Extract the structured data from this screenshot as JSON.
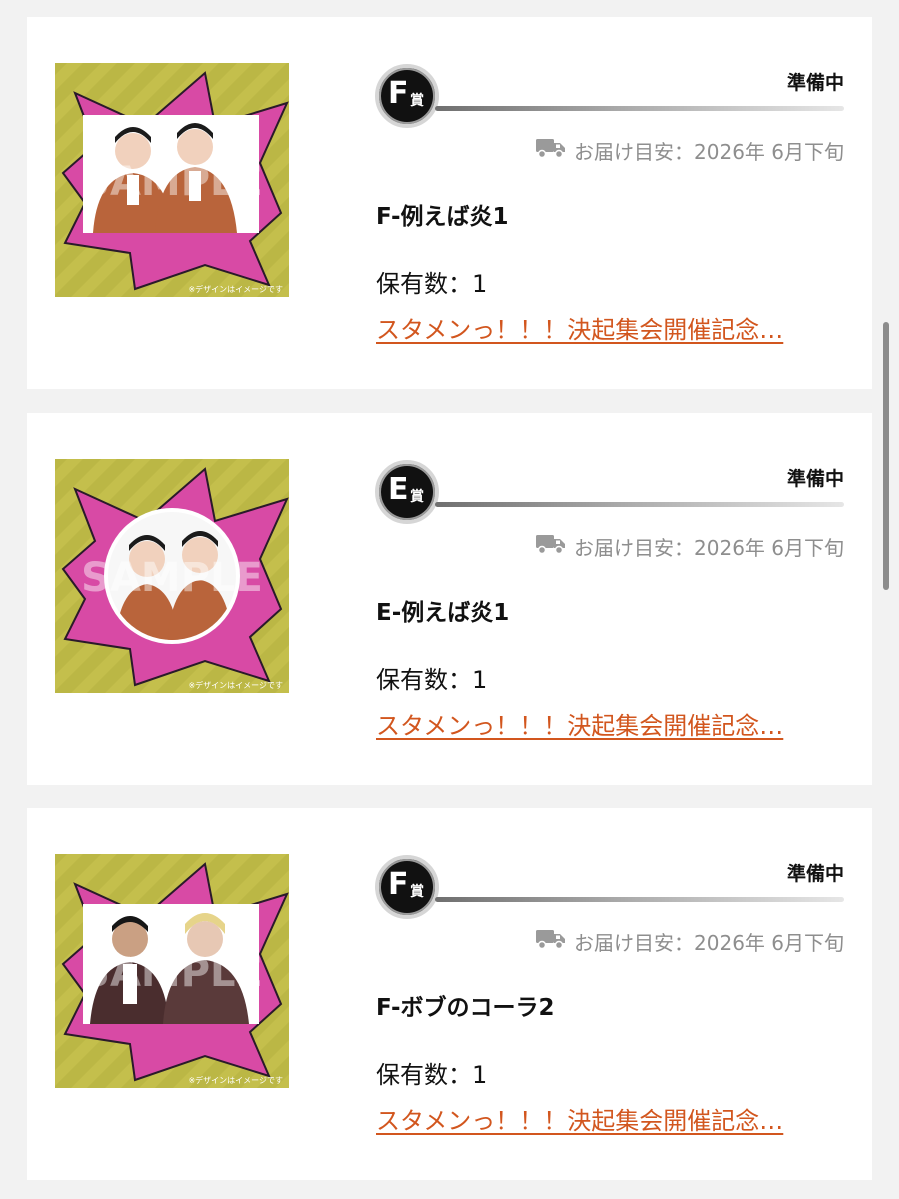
{
  "items": [
    {
      "prize_letter": "F",
      "prize_suffix": "賞",
      "status": "準備中",
      "delivery_label": "お届け目安：",
      "delivery_date": "2026年 6月下旬",
      "title": "F-例えば炎1",
      "quantity_label": "保有数：",
      "quantity": "1",
      "campaign_link": "スタメンっ！！！決起集会開催記念…",
      "image": {
        "watermark": "SAMPLE",
        "caption": "※デザインはイメージです",
        "background_color": "#c4bf4c",
        "burst_color": "#d84aa5",
        "shape": "square",
        "photo_description_icon": "photo-two-people-icon"
      }
    },
    {
      "prize_letter": "E",
      "prize_suffix": "賞",
      "status": "準備中",
      "delivery_label": "お届け目安：",
      "delivery_date": "2026年 6月下旬",
      "title": "E-例えば炎1",
      "quantity_label": "保有数：",
      "quantity": "1",
      "campaign_link": "スタメンっ！！！決起集会開催記念…",
      "image": {
        "watermark": "SAMPLE",
        "caption": "※デザインはイメージです",
        "background_color": "#c4bf4c",
        "burst_color": "#d84aa5",
        "shape": "circle",
        "photo_description_icon": "photo-two-people-icon"
      }
    },
    {
      "prize_letter": "F",
      "prize_suffix": "賞",
      "status": "準備中",
      "delivery_label": "お届け目安：",
      "delivery_date": "2026年 6月下旬",
      "title": "F-ボブのコーラ2",
      "quantity_label": "保有数：",
      "quantity": "1",
      "campaign_link": "スタメンっ！！！決起集会開催記念…",
      "image": {
        "watermark": "SAMPLE",
        "caption": "※デザインはイメージです",
        "background_color": "#c4bf4c",
        "burst_color": "#d84aa5",
        "shape": "square",
        "photo_description_icon": "photo-two-people-icon"
      }
    }
  ],
  "colors": {
    "link": "#d2561e",
    "muted_text": "#8e8e8e",
    "badge": "#111111"
  },
  "icons": {
    "delivery": "truck-icon"
  }
}
